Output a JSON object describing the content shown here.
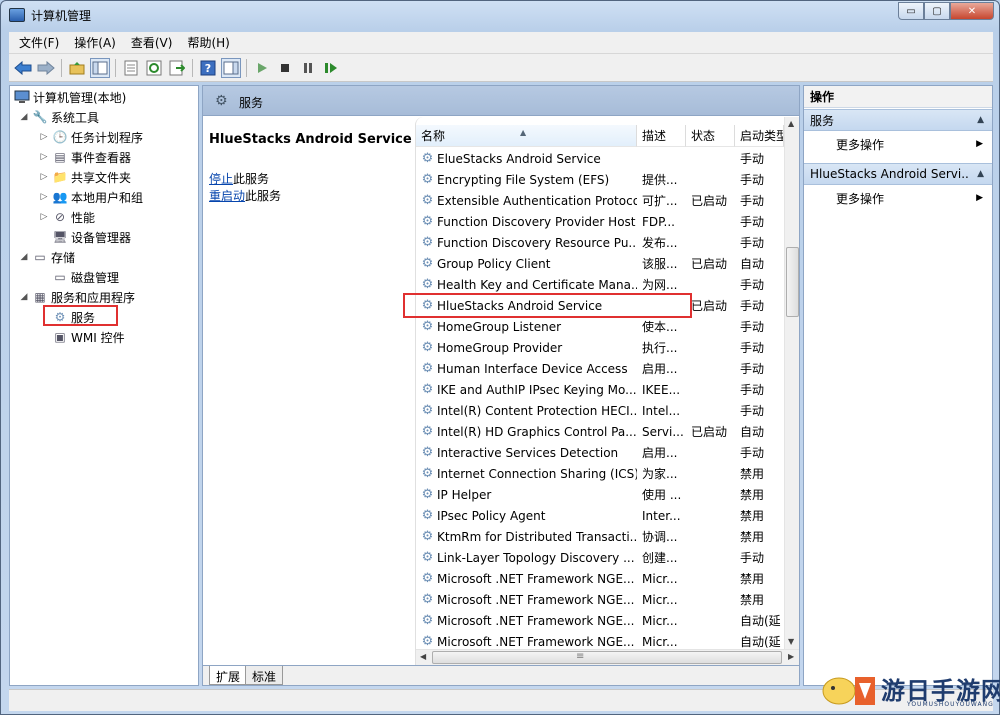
{
  "window": {
    "title": "计算机管理",
    "minimize_glyph": "▭",
    "maximize_glyph": "▢",
    "close_glyph": "✕"
  },
  "menu": [
    "文件(F)",
    "操作(A)",
    "查看(V)",
    "帮助(H)"
  ],
  "toolbar_icons": [
    "back-arrow-icon",
    "forward-arrow-icon",
    "up-folder-icon",
    "show-tree-icon",
    "properties-icon",
    "refresh-icon",
    "export-icon",
    "help-icon",
    "action-pane-icon",
    "play-icon",
    "stop-icon",
    "pause-icon",
    "resume-icon"
  ],
  "tree": {
    "root": "计算机管理(本地)",
    "items": [
      {
        "label": "系统工具",
        "level": 1,
        "expander": "expanded",
        "icon": "tools-icon"
      },
      {
        "label": "任务计划程序",
        "level": 2,
        "expander": "collapsed",
        "icon": "clock-icon"
      },
      {
        "label": "事件查看器",
        "level": 2,
        "expander": "collapsed",
        "icon": "event-viewer-icon"
      },
      {
        "label": "共享文件夹",
        "level": 2,
        "expander": "collapsed",
        "icon": "shared-folder-icon"
      },
      {
        "label": "本地用户和组",
        "level": 2,
        "expander": "collapsed",
        "icon": "users-icon"
      },
      {
        "label": "性能",
        "level": 2,
        "expander": "collapsed",
        "icon": "performance-icon"
      },
      {
        "label": "设备管理器",
        "level": 2,
        "expander": "none",
        "icon": "device-manager-icon"
      },
      {
        "label": "存储",
        "level": 1,
        "expander": "expanded",
        "icon": "storage-icon"
      },
      {
        "label": "磁盘管理",
        "level": 2,
        "expander": "none",
        "icon": "disk-icon"
      },
      {
        "label": "服务和应用程序",
        "level": 1,
        "expander": "expanded",
        "icon": "services-apps-icon"
      },
      {
        "label": "服务",
        "level": 2,
        "expander": "none",
        "icon": "gear-icon",
        "selected": true
      },
      {
        "label": "WMI 控件",
        "level": 2,
        "expander": "none",
        "icon": "wmi-icon"
      }
    ]
  },
  "center": {
    "header": "服务",
    "selected_service": "HlueStacks Android Service",
    "stop_link": "停止",
    "stop_rest": "此服务",
    "restart_link": "重启动",
    "restart_rest": "此服务",
    "columns": [
      "名称",
      "描述",
      "状态",
      "启动类型"
    ],
    "rows": [
      [
        "ElueStacks Android Service",
        "",
        "",
        "手动"
      ],
      [
        "Encrypting File System (EFS)",
        "提供...",
        "",
        "手动"
      ],
      [
        "Extensible Authentication Protocol",
        "可扩...",
        "已启动",
        "手动"
      ],
      [
        "Function Discovery Provider Host",
        "FDP...",
        "",
        "手动"
      ],
      [
        "Function Discovery Resource Pu...",
        "发布...",
        "",
        "手动"
      ],
      [
        "Group Policy Client",
        "该服...",
        "已启动",
        "自动"
      ],
      [
        "Health Key and Certificate Mana...",
        "为网...",
        "",
        "手动"
      ],
      [
        "HlueStacks Android Service",
        "",
        "已启动",
        "手动"
      ],
      [
        "HomeGroup Listener",
        "使本...",
        "",
        "手动"
      ],
      [
        "HomeGroup Provider",
        "执行...",
        "",
        "手动"
      ],
      [
        "Human Interface Device Access",
        "启用...",
        "",
        "手动"
      ],
      [
        "IKE and AuthIP IPsec Keying Mo...",
        "IKEE...",
        "",
        "手动"
      ],
      [
        "Intel(R) Content Protection HECI...",
        "Intel...",
        "",
        "手动"
      ],
      [
        "Intel(R) HD Graphics Control Pa...",
        "Servi...",
        "已启动",
        "自动"
      ],
      [
        "Interactive Services Detection",
        "启用...",
        "",
        "手动"
      ],
      [
        "Internet Connection Sharing (ICS)",
        "为家...",
        "",
        "禁用"
      ],
      [
        "IP Helper",
        "使用 ...",
        "",
        "禁用"
      ],
      [
        "IPsec Policy Agent",
        "Inter...",
        "",
        "禁用"
      ],
      [
        "KtmRm for Distributed Transacti...",
        "协调...",
        "",
        "禁用"
      ],
      [
        "Link-Layer Topology Discovery ...",
        "创建...",
        "",
        "手动"
      ],
      [
        "Microsoft .NET Framework NGE...",
        "Micr...",
        "",
        "禁用"
      ],
      [
        "Microsoft .NET Framework NGE...",
        "Micr...",
        "",
        "禁用"
      ],
      [
        "Microsoft .NET Framework NGE...",
        "Micr...",
        "",
        "自动(延"
      ],
      [
        "Microsoft .NET Framework NGE...",
        "Micr...",
        "",
        "自动(延"
      ]
    ],
    "tabs": [
      "扩展",
      "标准"
    ]
  },
  "actions": {
    "header": "操作",
    "groups": [
      {
        "title": "服务",
        "items": [
          "更多操作"
        ]
      },
      {
        "title": "HlueStacks Android Servi...",
        "items": [
          "更多操作"
        ]
      }
    ]
  },
  "watermark": {
    "text": "游日手游网",
    "sub": "YOUMUSHOUYOUWANG"
  },
  "colors": {
    "highlight_border": "#e03030",
    "link": "#0645ad",
    "header_blue": "#b6c9e2"
  }
}
